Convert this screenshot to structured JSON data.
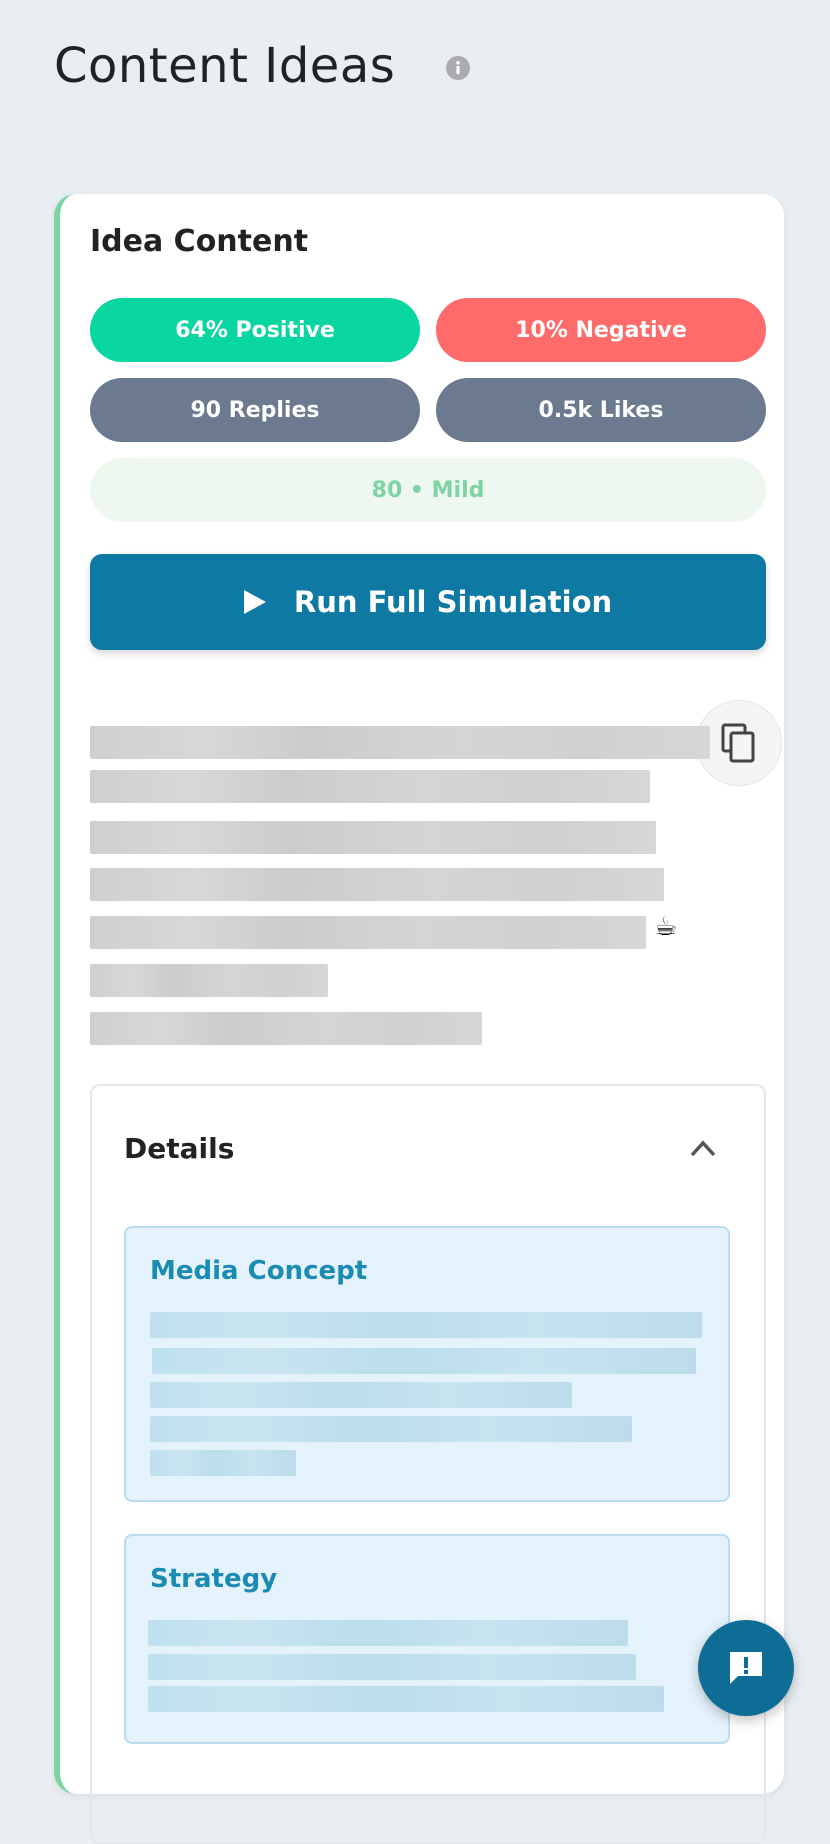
{
  "header": {
    "title": "Content Ideas",
    "info_icon": "info-icon"
  },
  "card": {
    "title": "Idea Content",
    "accent_color": "#7dd3a1",
    "stats": {
      "positive": "64% Positive",
      "negative": "10% Negative",
      "replies": "90 Replies",
      "likes": "0.5k Likes",
      "intensity": "80 • Mild"
    },
    "run_button": {
      "label": "Run Full Simulation",
      "icon": "play-icon",
      "color": "#0e7aa4"
    },
    "copy_icon": "copy-icon",
    "content_emoji": "☕",
    "details": {
      "title": "Details",
      "toggle_icon": "chevron-up-icon",
      "sections": [
        {
          "title": "Media Concept"
        },
        {
          "title": "Strategy"
        }
      ]
    }
  },
  "chat_fab": {
    "icon": "feedback-icon"
  },
  "colors": {
    "positive": "#09d6a0",
    "negative": "#ff6b6b",
    "neutral": "#6b7a8e",
    "mild_bg": "#eef8f1",
    "mild_text": "#7dd3a1",
    "section_title": "#1a8bb3"
  }
}
